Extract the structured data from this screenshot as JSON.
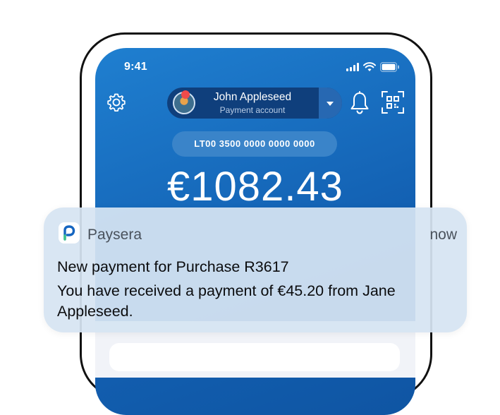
{
  "status_bar": {
    "time": "9:41",
    "icons": [
      "signal-icon",
      "wifi-icon",
      "battery-icon"
    ]
  },
  "header": {
    "account_name": "John Appleseed",
    "account_type": "Payment account",
    "icons": [
      "gear-icon",
      "bell-icon",
      "qr-code-icon"
    ]
  },
  "account": {
    "iban": "LT00 3500 0000 0000 0000",
    "balance": "€1082.43"
  },
  "notification": {
    "app_name": "Paysera",
    "time": "now",
    "title": "New payment for Purchase R3617",
    "body": "You have received a payment of €45.20 from Jane Appleseed."
  },
  "colors": {
    "screen_gradient_top": "#1f7fd0",
    "screen_gradient_bottom": "#0f55a3",
    "pill": "#0f3f7c",
    "iban_chip": "#3a84c9",
    "notification_bg": "#d6e4f2",
    "brand_blue": "#1565c0",
    "brand_green": "#3cc48a"
  }
}
